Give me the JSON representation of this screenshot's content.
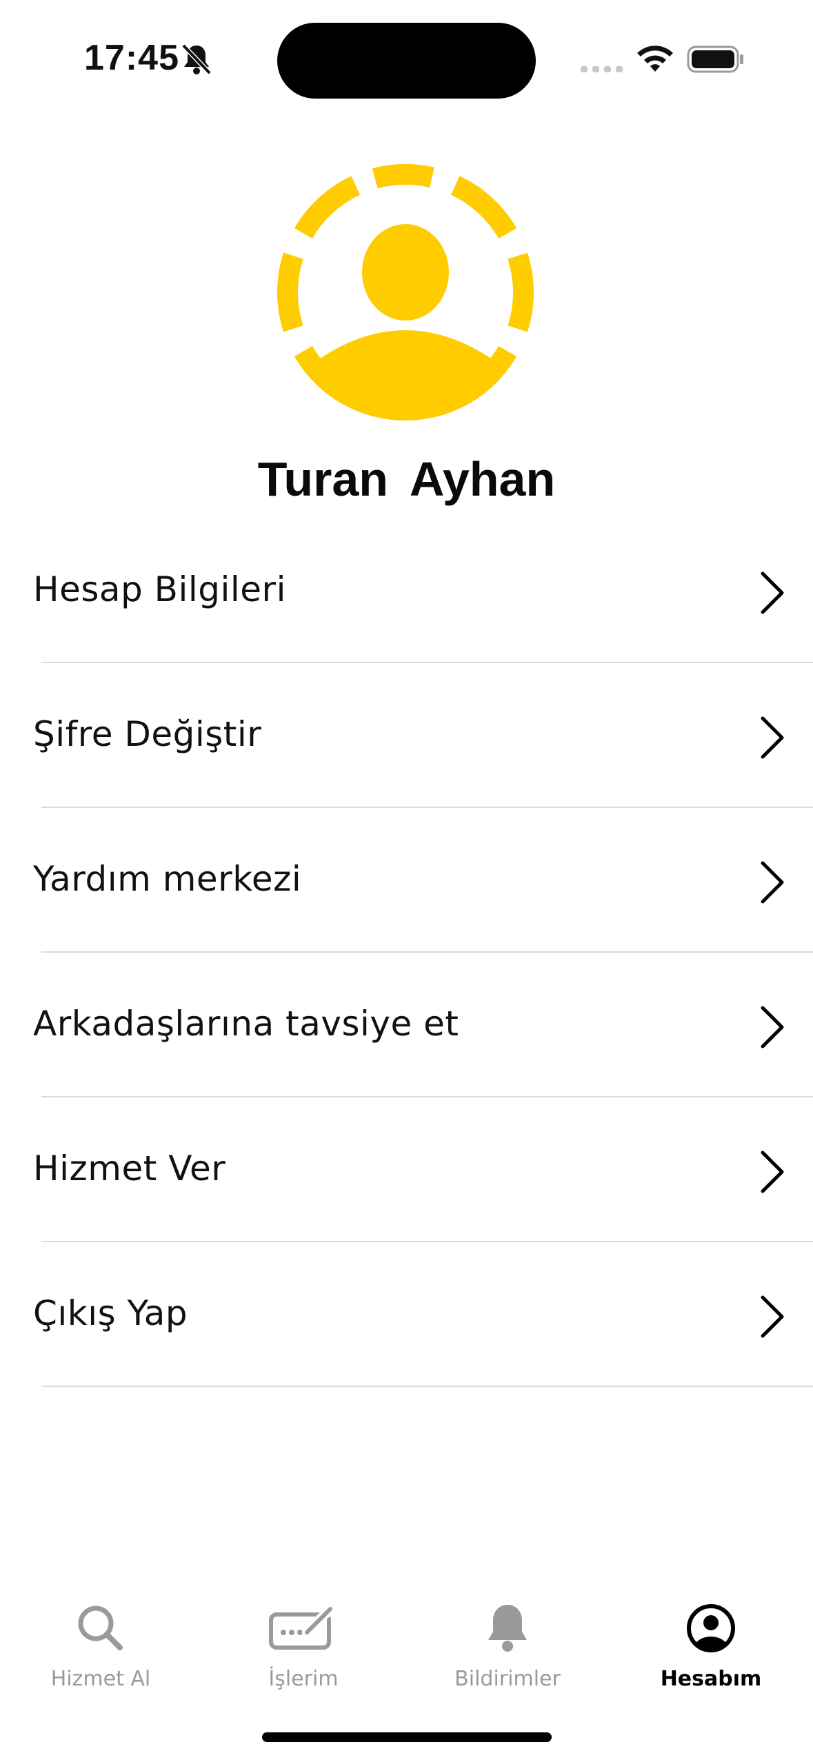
{
  "status_bar": {
    "time": "17:45",
    "icons": [
      "bell-slash-icon",
      "signal-icon",
      "wifi-icon",
      "battery-icon"
    ]
  },
  "profile": {
    "avatar_icon": "person-circle-icon",
    "accent_color": "#FFCC00",
    "name": "Turan  Ayhan"
  },
  "menu": {
    "items": [
      {
        "label": "Hesap Bilgileri"
      },
      {
        "label": "Şifre Değiştir"
      },
      {
        "label": "Yardım merkezi"
      },
      {
        "label": "Arkadaşlarına tavsiye et"
      },
      {
        "label": "Hizmet Ver"
      },
      {
        "label": "Çıkış Yap"
      }
    ]
  },
  "tab_bar": {
    "tabs": [
      {
        "label": "Hizmet Al",
        "icon": "search-icon",
        "active": false
      },
      {
        "label": "İşlerim",
        "icon": "signature-pen-icon",
        "active": false
      },
      {
        "label": "Bildirimler",
        "icon": "bell-icon",
        "active": false
      },
      {
        "label": "Hesabım",
        "icon": "person-circle-icon",
        "active": true
      }
    ],
    "active_color": "#000000",
    "inactive_color": "#9A9A9A"
  }
}
